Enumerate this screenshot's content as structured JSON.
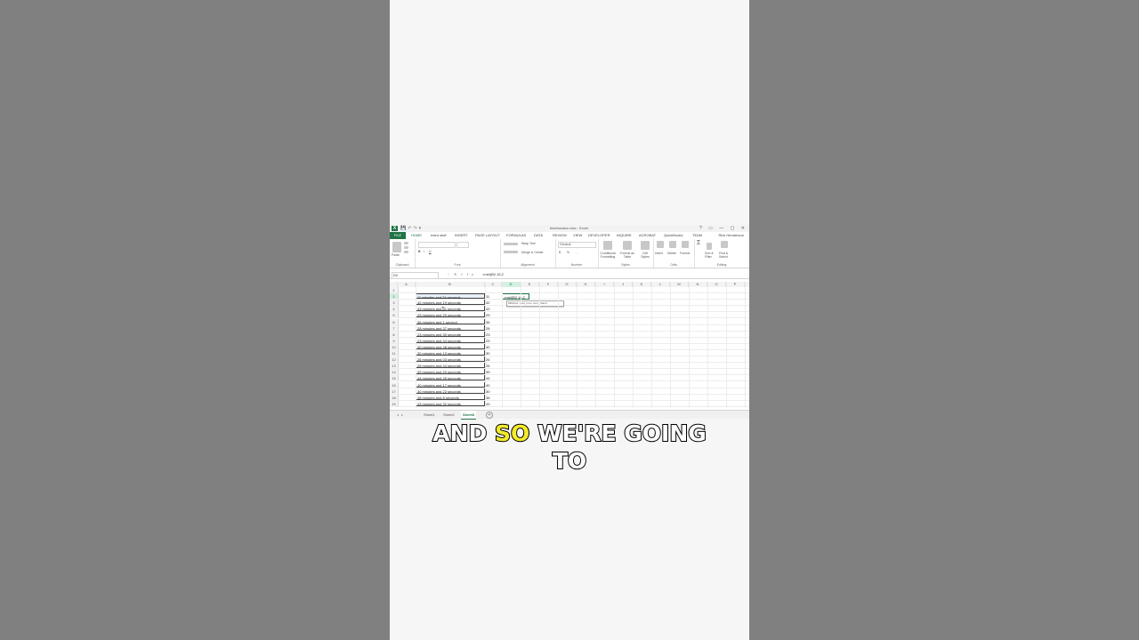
{
  "window": {
    "title": "timefunction.xlsx - Excel",
    "controls": "? ▭ — ▢ ✕"
  },
  "ribbon_tabs": [
    "FILE",
    "HOME",
    "extra stuff",
    "INSERT",
    "PAGE LAYOUT",
    "FORMULAS",
    "DATA",
    "REVIEW",
    "VIEW",
    "DEVELOPER",
    "INQUIRE",
    "ACROBAT",
    "QuickBooks",
    "TEAM"
  ],
  "user": "Rick Henderson",
  "ribbon_groups": {
    "clipboard": "Clipboard",
    "font": "Font",
    "alignment": "Alignment",
    "number": "Number",
    "styles": "Styles",
    "cells": "Cells",
    "editing": "Editing",
    "wrap_text": "Wrap Text",
    "merge_center": "Merge & Center",
    "number_format": "General",
    "conditional_formatting": "Conditional Formatting",
    "format_as_table": "Format as Table",
    "cell_styles": "Cell Styles",
    "insert": "Insert",
    "delete": "Delete",
    "format": "Format",
    "sort_filter": "Sort & Filter",
    "find_select": "Find & Select",
    "paste": "Paste"
  },
  "formula_bar": {
    "name_box": "D2",
    "formula": "=mid(B2,16,2"
  },
  "columns": [
    "A",
    "B",
    "C",
    "D",
    "E",
    "F",
    "G",
    "H",
    "I",
    "J",
    "K",
    "L",
    "M",
    "N",
    "O",
    "P"
  ],
  "rows": [
    {
      "n": "1",
      "b": "",
      "c": ""
    },
    {
      "n": "2",
      "b": "11 minutes and 24 seconds",
      "c": "11"
    },
    {
      "n": "3",
      "b": "42 minutes and 19 seconds",
      "c": "42"
    },
    {
      "n": "4",
      "b": "43 minutes and 31 seconds",
      "c": "43"
    },
    {
      "n": "5",
      "b": "29 minutes and 20 seconds",
      "c": "29"
    },
    {
      "n": "6",
      "b": "36 minutes and 1 second",
      "c": "36"
    },
    {
      "n": "7",
      "b": "28 minutes and 37 seconds",
      "c": "28"
    },
    {
      "n": "8",
      "b": "23 minutes and 30 seconds",
      "c": "23"
    },
    {
      "n": "9",
      "b": "23 minutes and 44 seconds",
      "c": "23"
    },
    {
      "n": "10",
      "b": "40 minutes and 48 seconds",
      "c": "40"
    },
    {
      "n": "11",
      "b": "30 minutes and 13 seconds",
      "c": "30"
    },
    {
      "n": "12",
      "b": "26 minutes and 03 seconds",
      "c": "26"
    },
    {
      "n": "13",
      "b": "26 minutes and 44 seconds",
      "c": "26"
    },
    {
      "n": "14",
      "b": "39 minutes and 20 seconds",
      "c": "39"
    },
    {
      "n": "15",
      "b": "44 minutes and 45 seconds",
      "c": "44"
    },
    {
      "n": "16",
      "b": "40 minutes and 17 seconds",
      "c": "40"
    },
    {
      "n": "17",
      "b": "30 minutes and 22 seconds",
      "c": "30"
    },
    {
      "n": "18",
      "b": "38 minutes and 8 seconds",
      "c": "38"
    },
    {
      "n": "19",
      "b": "43 minutes and 32 seconds",
      "c": "43"
    }
  ],
  "active_cell": {
    "text": "=mid(B2,16,2",
    "tooltip": "MID(text, start_num, num_chars)"
  },
  "sheets": [
    "Sheet1",
    "Sheet2",
    "Sheet3"
  ],
  "active_sheet": "Sheet3",
  "caption": {
    "line1_a": "AND",
    "line1_hl": "SO",
    "line1_b": "WE'RE GOING",
    "line2": "TO"
  },
  "colors": {
    "excel_green": "#217346",
    "caption_highlight": "#f3ea2b",
    "background": "#808080"
  }
}
